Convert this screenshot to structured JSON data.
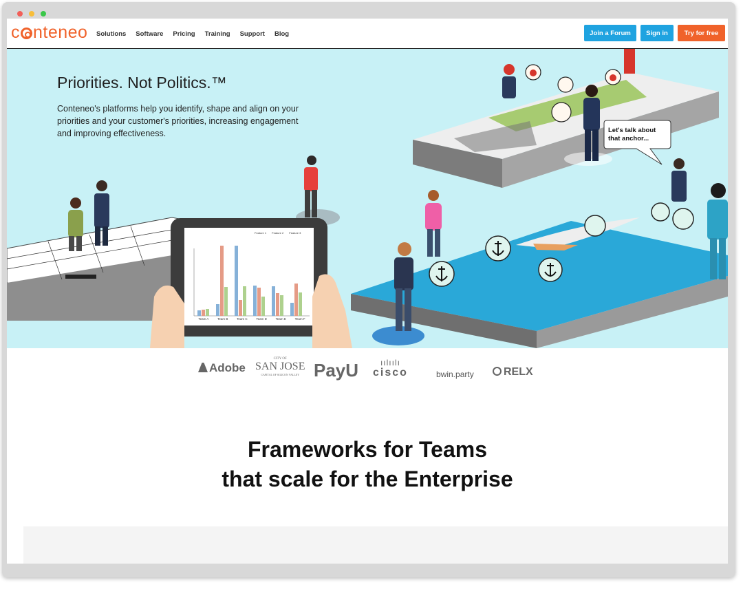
{
  "brand": {
    "name": "conteneo",
    "color": "#f0622a"
  },
  "nav": {
    "items": [
      "Solutions",
      "Software",
      "Pricing",
      "Training",
      "Support",
      "Blog"
    ],
    "join_forum": "Join a Forum",
    "sign_in": "Sign in",
    "try_free": "Try for free"
  },
  "colors": {
    "blue_button": "#1fa3e0",
    "orange_button": "#f0622a",
    "hero_bg": "#c8f1f6",
    "water": "#2aa8d8"
  },
  "hero": {
    "title": "Priorities. Not Politics.™",
    "text": "Conteneo's platforms help you identify, shape and align on your priorities and your customer's priorities, increasing engagement and improving effectiveness.",
    "speech_bubble": "Let's talk about that anchor..."
  },
  "tablet_chart": {
    "legend": [
      "Feature 1",
      "Feature 2",
      "Feature 3"
    ],
    "teams": [
      "Team A",
      "Team B",
      "Team C",
      "Team D",
      "Team E",
      "Team F"
    ]
  },
  "client_logos": [
    "Adobe",
    "SAN JOSE",
    "PayU",
    "cisco",
    "bwin.party",
    "RELX"
  ],
  "client_logo_small": {
    "city_of": "CITY OF",
    "capital": "CAPITAL OF SILICON VALLEY"
  },
  "section": {
    "title_line1": "Frameworks for Teams",
    "title_line2": "that scale for the Enterprise"
  }
}
